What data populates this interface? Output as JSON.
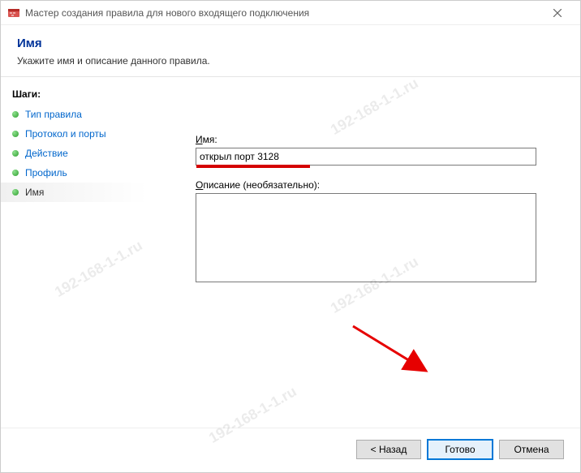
{
  "window": {
    "title": "Мастер создания правила для нового входящего подключения"
  },
  "header": {
    "title": "Имя",
    "description": "Укажите имя и описание данного правила."
  },
  "sidebar": {
    "heading": "Шаги:",
    "steps": [
      {
        "label": "Тип правила",
        "active": false
      },
      {
        "label": "Протокол и порты",
        "active": false
      },
      {
        "label": "Действие",
        "active": false
      },
      {
        "label": "Профиль",
        "active": false
      },
      {
        "label": "Имя",
        "active": true
      }
    ]
  },
  "main": {
    "name_label_prefix": "И",
    "name_label_rest": "мя:",
    "name_value": "открыл порт 3128",
    "desc_label_prefix": "О",
    "desc_label_rest": "писание (необязательно):",
    "desc_value": ""
  },
  "footer": {
    "back": "< Назад",
    "finish": "Готово",
    "cancel": "Отмена"
  },
  "watermark_text": "192-168-1-1.ru"
}
